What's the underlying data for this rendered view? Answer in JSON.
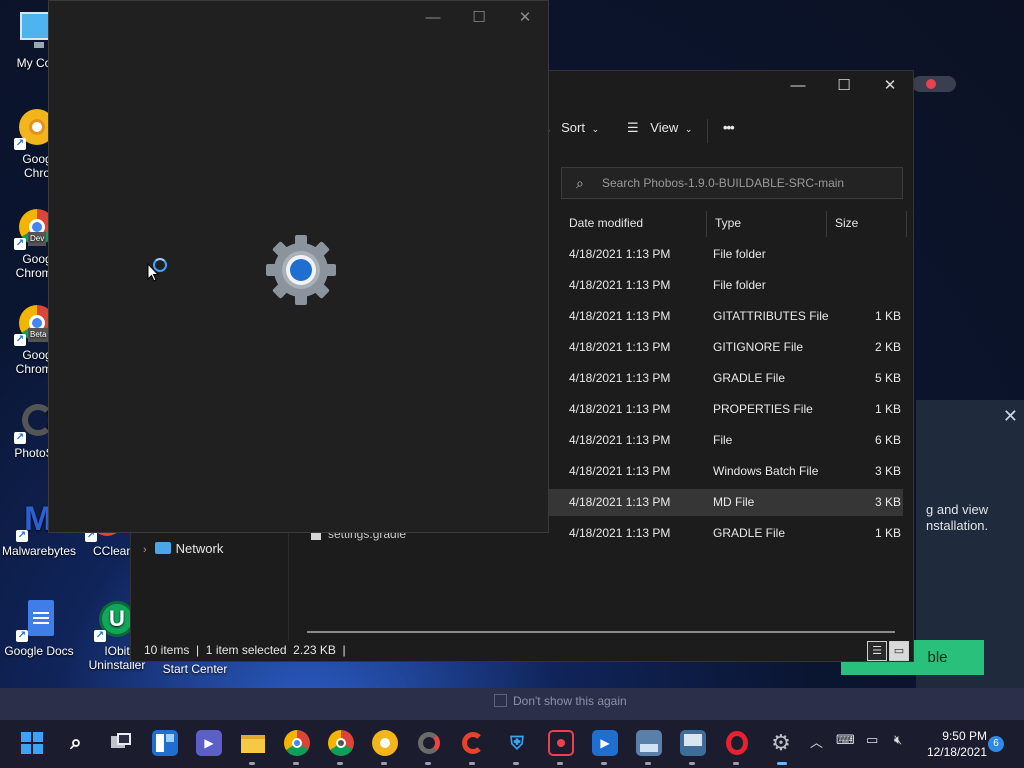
{
  "desktop": {
    "icons": [
      {
        "label": "My Com",
        "icon": "computer-icon"
      },
      {
        "label": "Goog\nChro",
        "icon": "chrome-canary-icon"
      },
      {
        "label": "Goog\nChrome",
        "icon": "chrome-dev-icon",
        "badge": "Dev"
      },
      {
        "label": "Goog\nChrome",
        "icon": "chrome-beta-icon",
        "badge": "Beta"
      },
      {
        "label": "PhotoSc",
        "icon": "photoscape-icon"
      },
      {
        "label": "Malwarebytes",
        "icon": "malwarebytes-icon"
      },
      {
        "label": "CClean",
        "icon": "ccleaner-icon"
      },
      {
        "label": "Google Docs",
        "icon": "google-docs-icon"
      },
      {
        "label": "IObit\nUninstaller",
        "icon": "iobit-uninstaller-icon"
      },
      {
        "label": "Start Center",
        "icon": "start-center-icon"
      }
    ]
  },
  "prompt": {
    "text": "g and view\nnstallation.",
    "button_label": "ble",
    "dont_show_label": "Don't show this again"
  },
  "explorer": {
    "toolbar": {
      "sort_label": "Sort",
      "view_label": "View",
      "more_label": "•••"
    },
    "search_placeholder": "Search Phobos-1.9.0-BUILDABLE-SRC-main",
    "columns": {
      "date": "Date modified",
      "type": "Type",
      "size": "Size"
    },
    "rows": [
      {
        "date": "4/18/2021 1:13 PM",
        "type": "File folder",
        "size": ""
      },
      {
        "date": "4/18/2021 1:13 PM",
        "type": "File folder",
        "size": ""
      },
      {
        "date": "4/18/2021 1:13 PM",
        "type": "GITATTRIBUTES File",
        "size": "1 KB"
      },
      {
        "date": "4/18/2021 1:13 PM",
        "type": "GITIGNORE File",
        "size": "2 KB"
      },
      {
        "date": "4/18/2021 1:13 PM",
        "type": "GRADLE File",
        "size": "5 KB"
      },
      {
        "date": "4/18/2021 1:13 PM",
        "type": "PROPERTIES File",
        "size": "1 KB"
      },
      {
        "date": "4/18/2021 1:13 PM",
        "type": "File",
        "size": "6 KB"
      },
      {
        "date": "4/18/2021 1:13 PM",
        "type": "Windows Batch File",
        "size": "3 KB"
      },
      {
        "date": "4/18/2021 1:13 PM",
        "type": "MD File",
        "size": "3 KB",
        "selected": true
      },
      {
        "date": "4/18/2021 1:13 PM",
        "type": "GRADLE File",
        "size": "1 KB"
      }
    ],
    "nav_network": "Network",
    "ghost_file": "settings.gradle",
    "status": "10 items  |  1 item selected  2.23 KB  |"
  },
  "taskbar": {
    "time": "9:50 PM",
    "date": "12/18/2021",
    "notification_count": "6",
    "apps": [
      "start-icon",
      "search-icon",
      "task-view-icon",
      "widgets-icon",
      "chat-icon",
      "file-explorer-icon",
      "chrome-icon",
      "chrome-dev-icon",
      "chrome-canary-icon",
      "photoscape-icon",
      "ccleaner-icon",
      "defender-icon",
      "screen-recorder-icon",
      "media-player-icon",
      "photo-viewer-icon",
      "control-panel-icon",
      "opera-icon",
      "settings-icon"
    ]
  },
  "colors": {
    "accent": "#2c8be6",
    "green_button": "#28c07a",
    "splash_bg": "#202020",
    "explorer_bg": "#1c1c1c"
  }
}
